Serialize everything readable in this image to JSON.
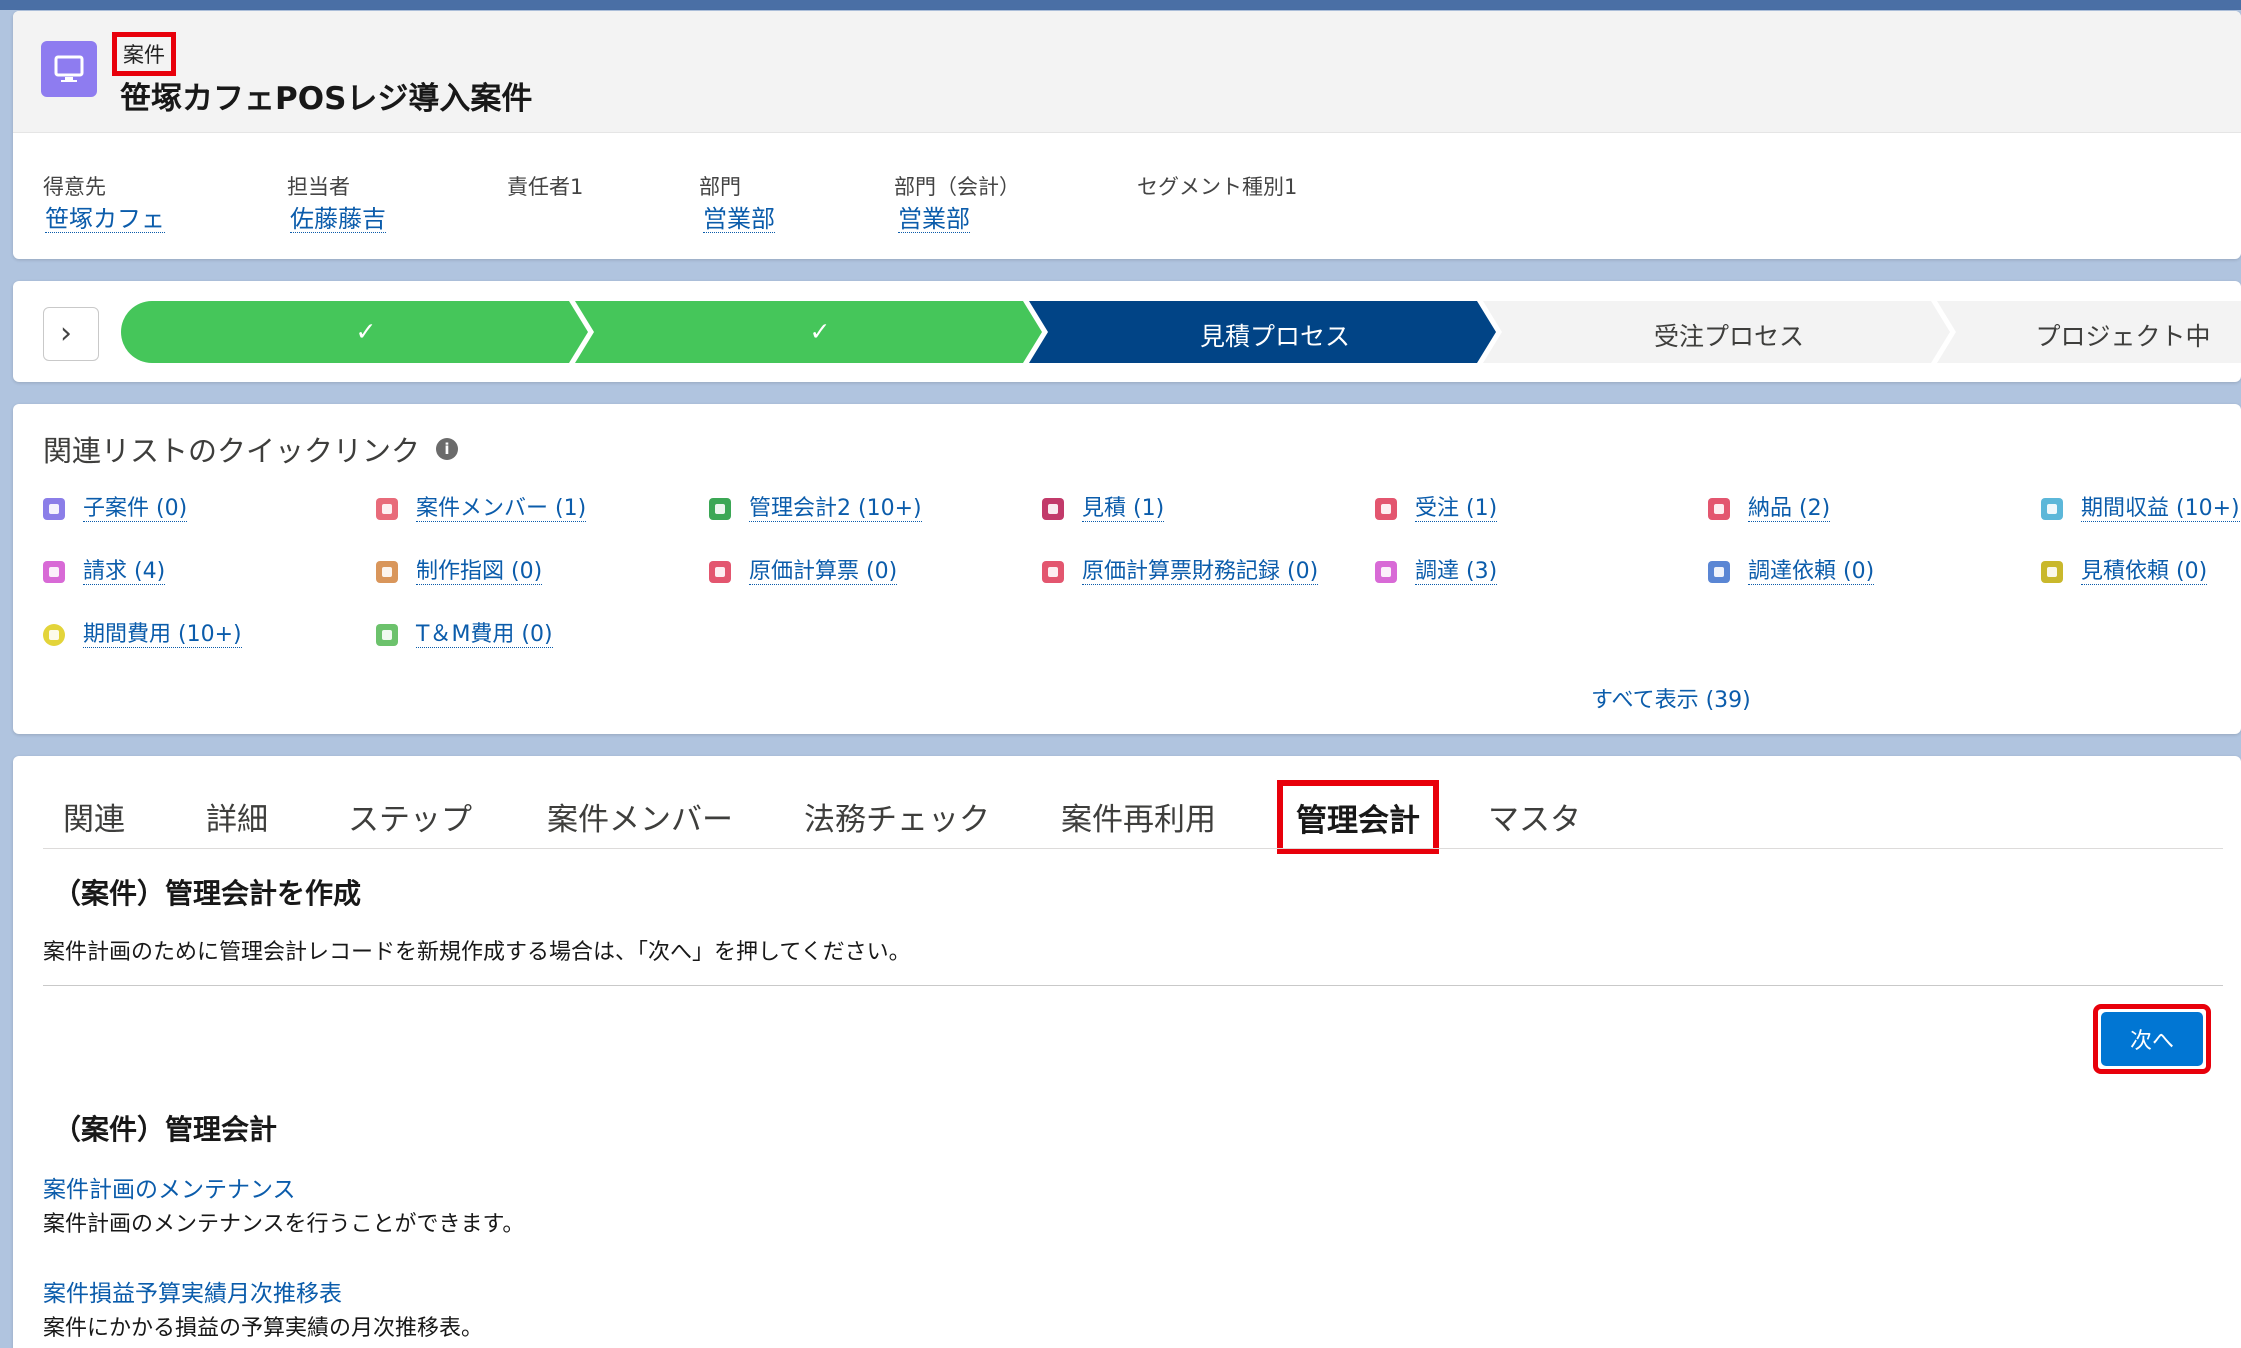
{
  "header": {
    "object_label": "案件",
    "record_title": "笹塚カフェPOSレジ導入案件",
    "fields": [
      {
        "label": "得意先",
        "value": "笹塚カフェ"
      },
      {
        "label": "担当者",
        "value": "佐藤藤吉"
      },
      {
        "label": "責任者1",
        "value": ""
      },
      {
        "label": "部門",
        "value": "営業部"
      },
      {
        "label": "部門（会計）",
        "value": "営業部"
      },
      {
        "label": "セグメント種別1",
        "value": ""
      }
    ]
  },
  "path": {
    "toggle_icon": "chevron-right-icon",
    "stages": [
      {
        "label": "✓",
        "status": "complete"
      },
      {
        "label": "✓",
        "status": "complete"
      },
      {
        "label": "見積プロセス",
        "status": "current"
      },
      {
        "label": "受注プロセス",
        "status": "incomplete"
      },
      {
        "label": "プロジェクト中",
        "status": "incomplete"
      }
    ],
    "colors": {
      "complete": "#45c65a",
      "current": "#014486",
      "incomplete": "#f3f3f3"
    }
  },
  "quick_links": {
    "title": "関連リストのクイックリンク",
    "info_icon": "info-icon",
    "items": [
      {
        "label": "子案件 (0)",
        "color": "#8b7ee8"
      },
      {
        "label": "案件メンバー (1)",
        "color": "#e86b7a"
      },
      {
        "label": "管理会計2 (10+)",
        "color": "#3ba755"
      },
      {
        "label": "見積 (1)",
        "color": "#c23a6a"
      },
      {
        "label": "受注 (1)",
        "color": "#e3566f"
      },
      {
        "label": "納品 (2)",
        "color": "#e3566f"
      },
      {
        "label": "期間収益 (10+)",
        "color": "#5cb7d9"
      },
      {
        "label": "請求 (4)",
        "color": "#d86ad6"
      },
      {
        "label": "制作指図 (0)",
        "color": "#d9965b"
      },
      {
        "label": "原価計算票 (0)",
        "color": "#e3566f"
      },
      {
        "label": "原価計算票財務記録 (0)",
        "color": "#e3566f"
      },
      {
        "label": "調達 (3)",
        "color": "#d86ad6"
      },
      {
        "label": "調達依頼 (0)",
        "color": "#5a86d4"
      },
      {
        "label": "見積依頼 (0)",
        "color": "#c9b82c"
      },
      {
        "label": "期間費用 (10+)",
        "color": "#e3d43a"
      },
      {
        "label": "T＆M費用 (0)",
        "color": "#6cc26c"
      }
    ],
    "show_all": "すべて表示 (39)"
  },
  "tabs": {
    "items": [
      "関連",
      "詳細",
      "ステップ",
      "案件メンバー",
      "法務チェック",
      "案件再利用",
      "管理会計",
      "マスタ"
    ],
    "active": "管理会計"
  },
  "content": {
    "create_title": "（案件）管理会計を作成",
    "create_desc": "案件計画のために管理会計レコードを新規作成する場合は、「次へ」を押してください。",
    "next_button": "次へ",
    "section_title": "（案件）管理会計",
    "links": [
      {
        "title": "案件計画のメンテナンス",
        "desc": "案件計画のメンテナンスを行うことができます。"
      },
      {
        "title": "案件損益予算実績月次推移表",
        "desc": "案件にかかる損益の予算実績の月次推移表。"
      }
    ]
  }
}
